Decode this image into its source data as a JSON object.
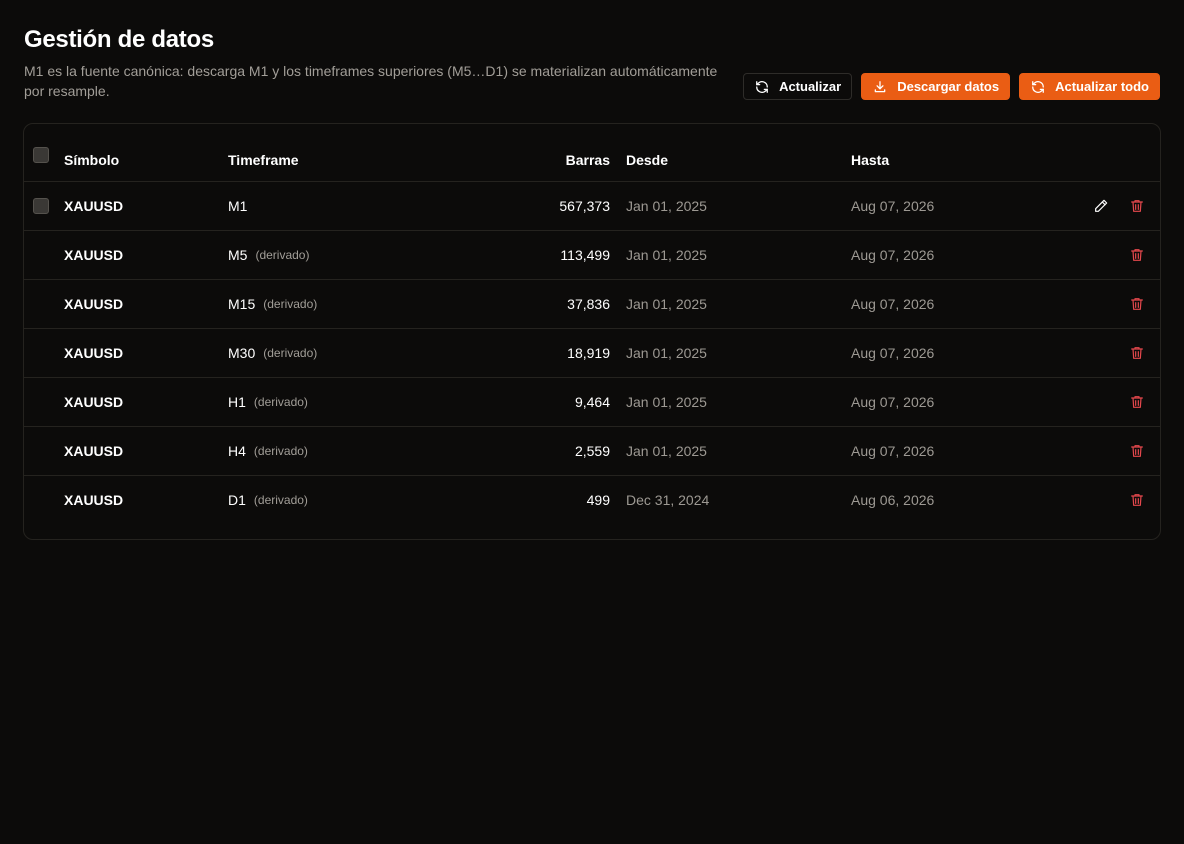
{
  "header": {
    "title": "Gestión de datos",
    "subtitle": "M1 es la fuente canónica: descarga M1 y los timeframes superiores (M5…D1) se materializan automáticamente por resample."
  },
  "actions": {
    "refresh_label": "Actualizar",
    "download_label": "Descargar datos",
    "refresh_all_label": "Actualizar todo",
    "accent_color": "#ea5d14"
  },
  "table": {
    "columns": {
      "symbol": "Símbolo",
      "timeframe": "Timeframe",
      "bars": "Barras",
      "from": "Desde",
      "to": "Hasta"
    },
    "rows": [
      {
        "symbol": "XAUUSD",
        "timeframe": "M1",
        "derived": "",
        "bars": "567,373",
        "from": "Jan 01, 2025",
        "to": "Aug 07, 2026"
      },
      {
        "symbol": "XAUUSD",
        "timeframe": "M5",
        "derived": "(derivado)",
        "bars": "113,499",
        "from": "Jan 01, 2025",
        "to": "Aug 07, 2026"
      },
      {
        "symbol": "XAUUSD",
        "timeframe": "M15",
        "derived": "(derivado)",
        "bars": "37,836",
        "from": "Jan 01, 2025",
        "to": "Aug 07, 2026"
      },
      {
        "symbol": "XAUUSD",
        "timeframe": "M30",
        "derived": "(derivado)",
        "bars": "18,919",
        "from": "Jan 01, 2025",
        "to": "Aug 07, 2026"
      },
      {
        "symbol": "XAUUSD",
        "timeframe": "H1",
        "derived": "(derivado)",
        "bars": "9,464",
        "from": "Jan 01, 2025",
        "to": "Aug 07, 2026"
      },
      {
        "symbol": "XAUUSD",
        "timeframe": "H4",
        "derived": "(derivado)",
        "bars": "2,559",
        "from": "Jan 01, 2025",
        "to": "Aug 07, 2026"
      },
      {
        "symbol": "XAUUSD",
        "timeframe": "D1",
        "derived": "(derivado)",
        "bars": "499",
        "from": "Dec 31, 2024",
        "to": "Aug 06, 2026"
      }
    ]
  },
  "icons": {
    "refresh": "refresh-icon",
    "download": "download-icon",
    "refresh_all": "refresh-all-icon",
    "edit": "pencil-icon",
    "delete": "trash-icon"
  },
  "colors": {
    "delete": "#e5484d"
  }
}
